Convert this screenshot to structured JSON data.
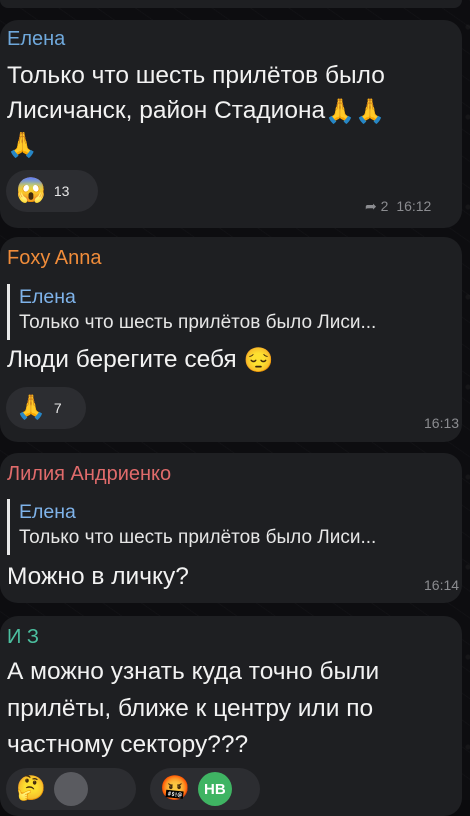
{
  "messages": [
    {
      "sender": "Елена",
      "sender_color": "#6fa8dc",
      "text_line1": "Только что шесть прилётов было",
      "text_line2": "Лисичанск, район Стадиона",
      "emoji_trail": "🙏🙏",
      "emoji_line3": "🙏",
      "reaction_emoji": "😱",
      "reaction_count": "13",
      "reply_count": "2",
      "time": "16:12"
    },
    {
      "sender": "Foxy Anna",
      "sender_color": "#f08c3a",
      "reply_to_name": "Елена",
      "reply_to_text": "Только что шесть прилётов было Лиси...",
      "text": "Люди берегите себя",
      "emoji_trail": "😔",
      "reaction_emoji": "🙏",
      "reaction_count": "7",
      "time": "16:13"
    },
    {
      "sender": "Лилия Андриенко",
      "sender_color": "#e06b6b",
      "reply_to_name": "Елена",
      "reply_to_text": "Только что шесть прилётов было Лиси...",
      "text": "Можно в личку?",
      "time": "16:14"
    },
    {
      "sender": "И З",
      "sender_color": "#4cc0a0",
      "text_line1": "А можно узнать куда точно были",
      "text_line2": "прилёты, ближе к центру или  по",
      "text_line3": "частному сектору???",
      "reaction1_emoji": "🤔",
      "reaction2_emoji": "🤬",
      "reaction2_avatar": "НВ"
    }
  ],
  "colors": {
    "bubble": "#1e1f22",
    "background": "#0d0d10",
    "time": "#8b8c90",
    "reply_name": "#7fb3ea",
    "avatar_nv": "#3fb463"
  }
}
